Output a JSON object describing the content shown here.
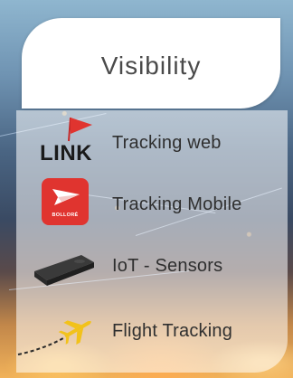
{
  "title": "Visibility",
  "items": [
    {
      "label": "Tracking web",
      "icon": "link-logo-icon",
      "logo_text": "LINK"
    },
    {
      "label": "Tracking Mobile",
      "icon": "bollore-app-icon",
      "logo_text": "BOLLORÉ"
    },
    {
      "label": "IoT - Sensors",
      "icon": "iot-sensor-device-icon"
    },
    {
      "label": "Flight Tracking",
      "icon": "airplane-icon"
    }
  ],
  "colors": {
    "accent_red": "#e0342f",
    "plane_yellow": "#f2c21a",
    "text_dark": "#2f2f2f"
  }
}
